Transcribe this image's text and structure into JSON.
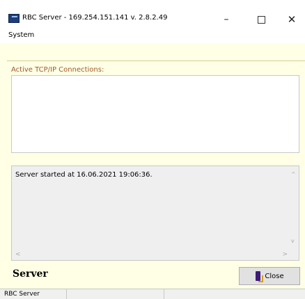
{
  "window": {
    "title": "RBC Server - 169.254.151.141 v. 2.8.2.49",
    "icon": "rbc-server-app-icon",
    "controls": {
      "minimize": "–",
      "close": "✕"
    }
  },
  "menu": {
    "items": [
      {
        "label": "System"
      }
    ]
  },
  "connections": {
    "label": "Active TCP/IP Connections:"
  },
  "log": {
    "lines": [
      "Server started at 16.06.2021 19:06:36."
    ],
    "scroll_up": "^",
    "scroll_down": "v",
    "scroll_left": "<",
    "scroll_right": ">"
  },
  "footer": {
    "title": "Server",
    "close_button": {
      "label": "Close",
      "icon": "door-exit-icon"
    }
  },
  "statusbar": {
    "cells": [
      "RBC Server",
      ""
    ]
  },
  "colors": {
    "background": "#ffffe6",
    "label_accent": "#a05a28",
    "log_background": "#efefef"
  }
}
